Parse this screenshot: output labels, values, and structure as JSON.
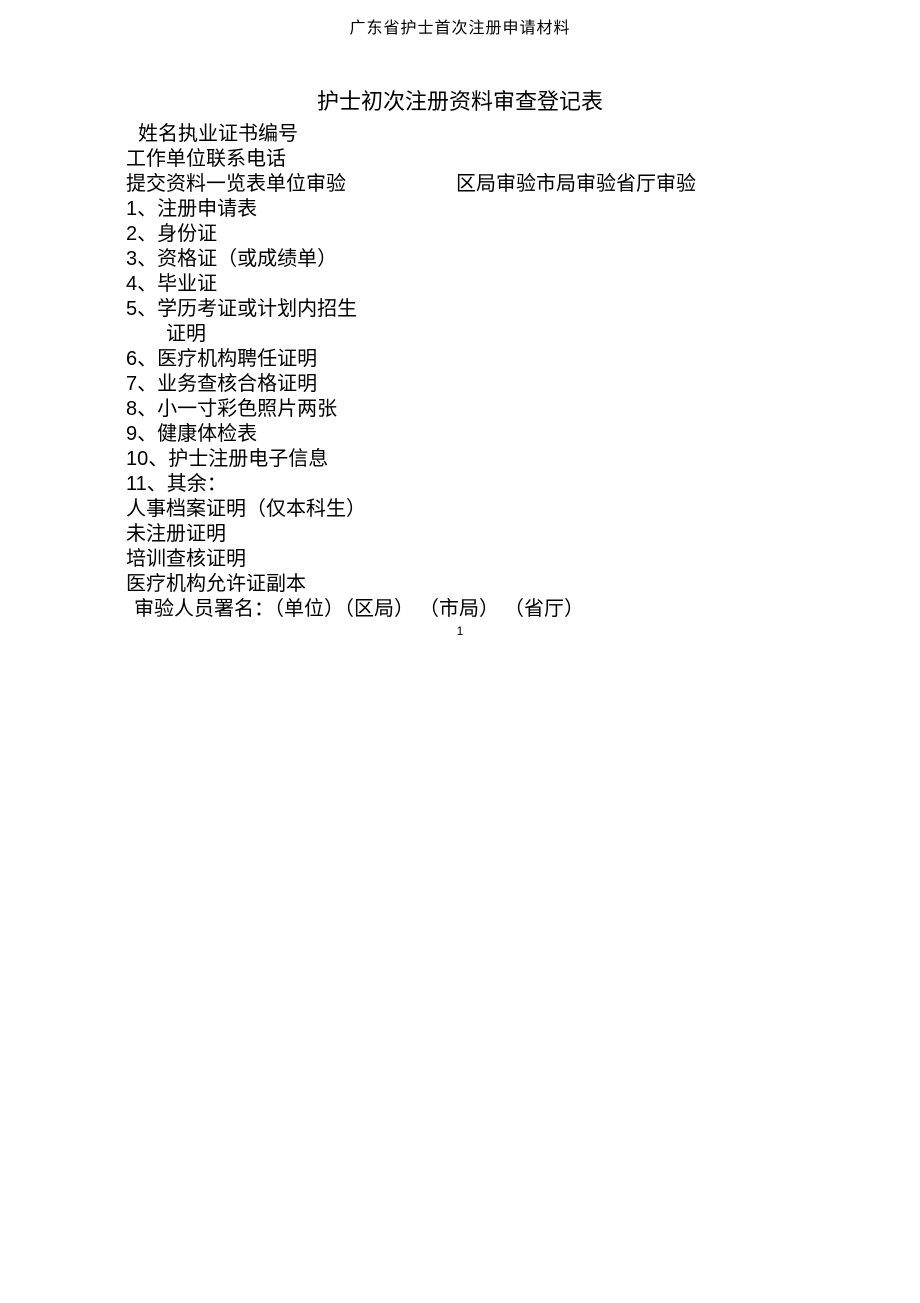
{
  "header": {
    "top_title": "广东省护士首次注册申请材料"
  },
  "title": "护士初次注册资料审查登记表",
  "row1": {
    "name_label": "姓名",
    "cert_label": "执业证书编号"
  },
  "row2": {
    "unit_label": "工作单位",
    "phone_label": "联系电话"
  },
  "row3": {
    "left_a": "提交资料一览表",
    "left_b": "单位审验",
    "right_a": "区局审验",
    "right_b": "市局审验",
    "right_c": "省厅审验"
  },
  "items": {
    "i1": "1、注册申请表",
    "i2": "2、身份证",
    "i3": "3、资格证（或成绩单）",
    "i4": "4、毕业证",
    "i5": "5、学历考证或计划内招生",
    "i5b": "证明",
    "i6": "6、医疗机构聘任证明",
    "i7": "7、业务查核合格证明",
    "i8": "8、小一寸彩色照片两张",
    "i9": "9、健康体检表",
    "i10": "10、护士注册电子信息",
    "i11": "11、其余：",
    "e1": "人事档案证明（仅本科生）",
    "e2": "未注册证明",
    "e3": "培训查核证明",
    "e4": "医疗机构允许证副本"
  },
  "sig": {
    "label": "审验人员署名：",
    "s1": "（单位）",
    "s2": "（区局）",
    "s3": "（市局）",
    "s4": "（省厅）"
  },
  "page_number": "1"
}
